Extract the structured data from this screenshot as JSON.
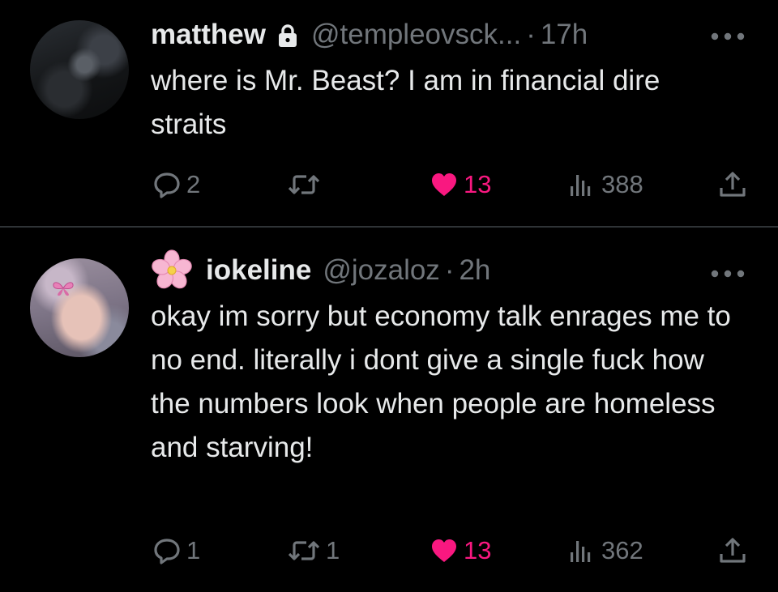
{
  "tweets": [
    {
      "name": "matthew",
      "handle": "@templeovsck...",
      "separator": "·",
      "time": "17h",
      "text": "where is Mr. Beast? I am in financial dire straits",
      "replies": "2",
      "retweets": "",
      "likes": "13",
      "views": "388",
      "icons": [
        "lock-icon",
        "more-icon",
        "reply-icon",
        "retweet-icon",
        "heart-icon",
        "views-icon",
        "share-icon"
      ]
    },
    {
      "name": "iokeline",
      "handle": "@jozaloz",
      "separator": "·",
      "time": "2h",
      "text": "okay im sorry but economy talk enrages me to no end. literally i dont give a single fuck how the numbers look when people are homeless and starving!",
      "replies": "1",
      "retweets": "1",
      "likes": "13",
      "views": "362",
      "icons": [
        "flower-icon",
        "more-icon",
        "reply-icon",
        "retweet-icon",
        "heart-icon",
        "views-icon",
        "share-icon"
      ]
    }
  ],
  "colors": {
    "background": "#000000",
    "text": "#e7e9ea",
    "secondary": "#71767b",
    "like": "#f91880",
    "divider": "#2f3336"
  }
}
